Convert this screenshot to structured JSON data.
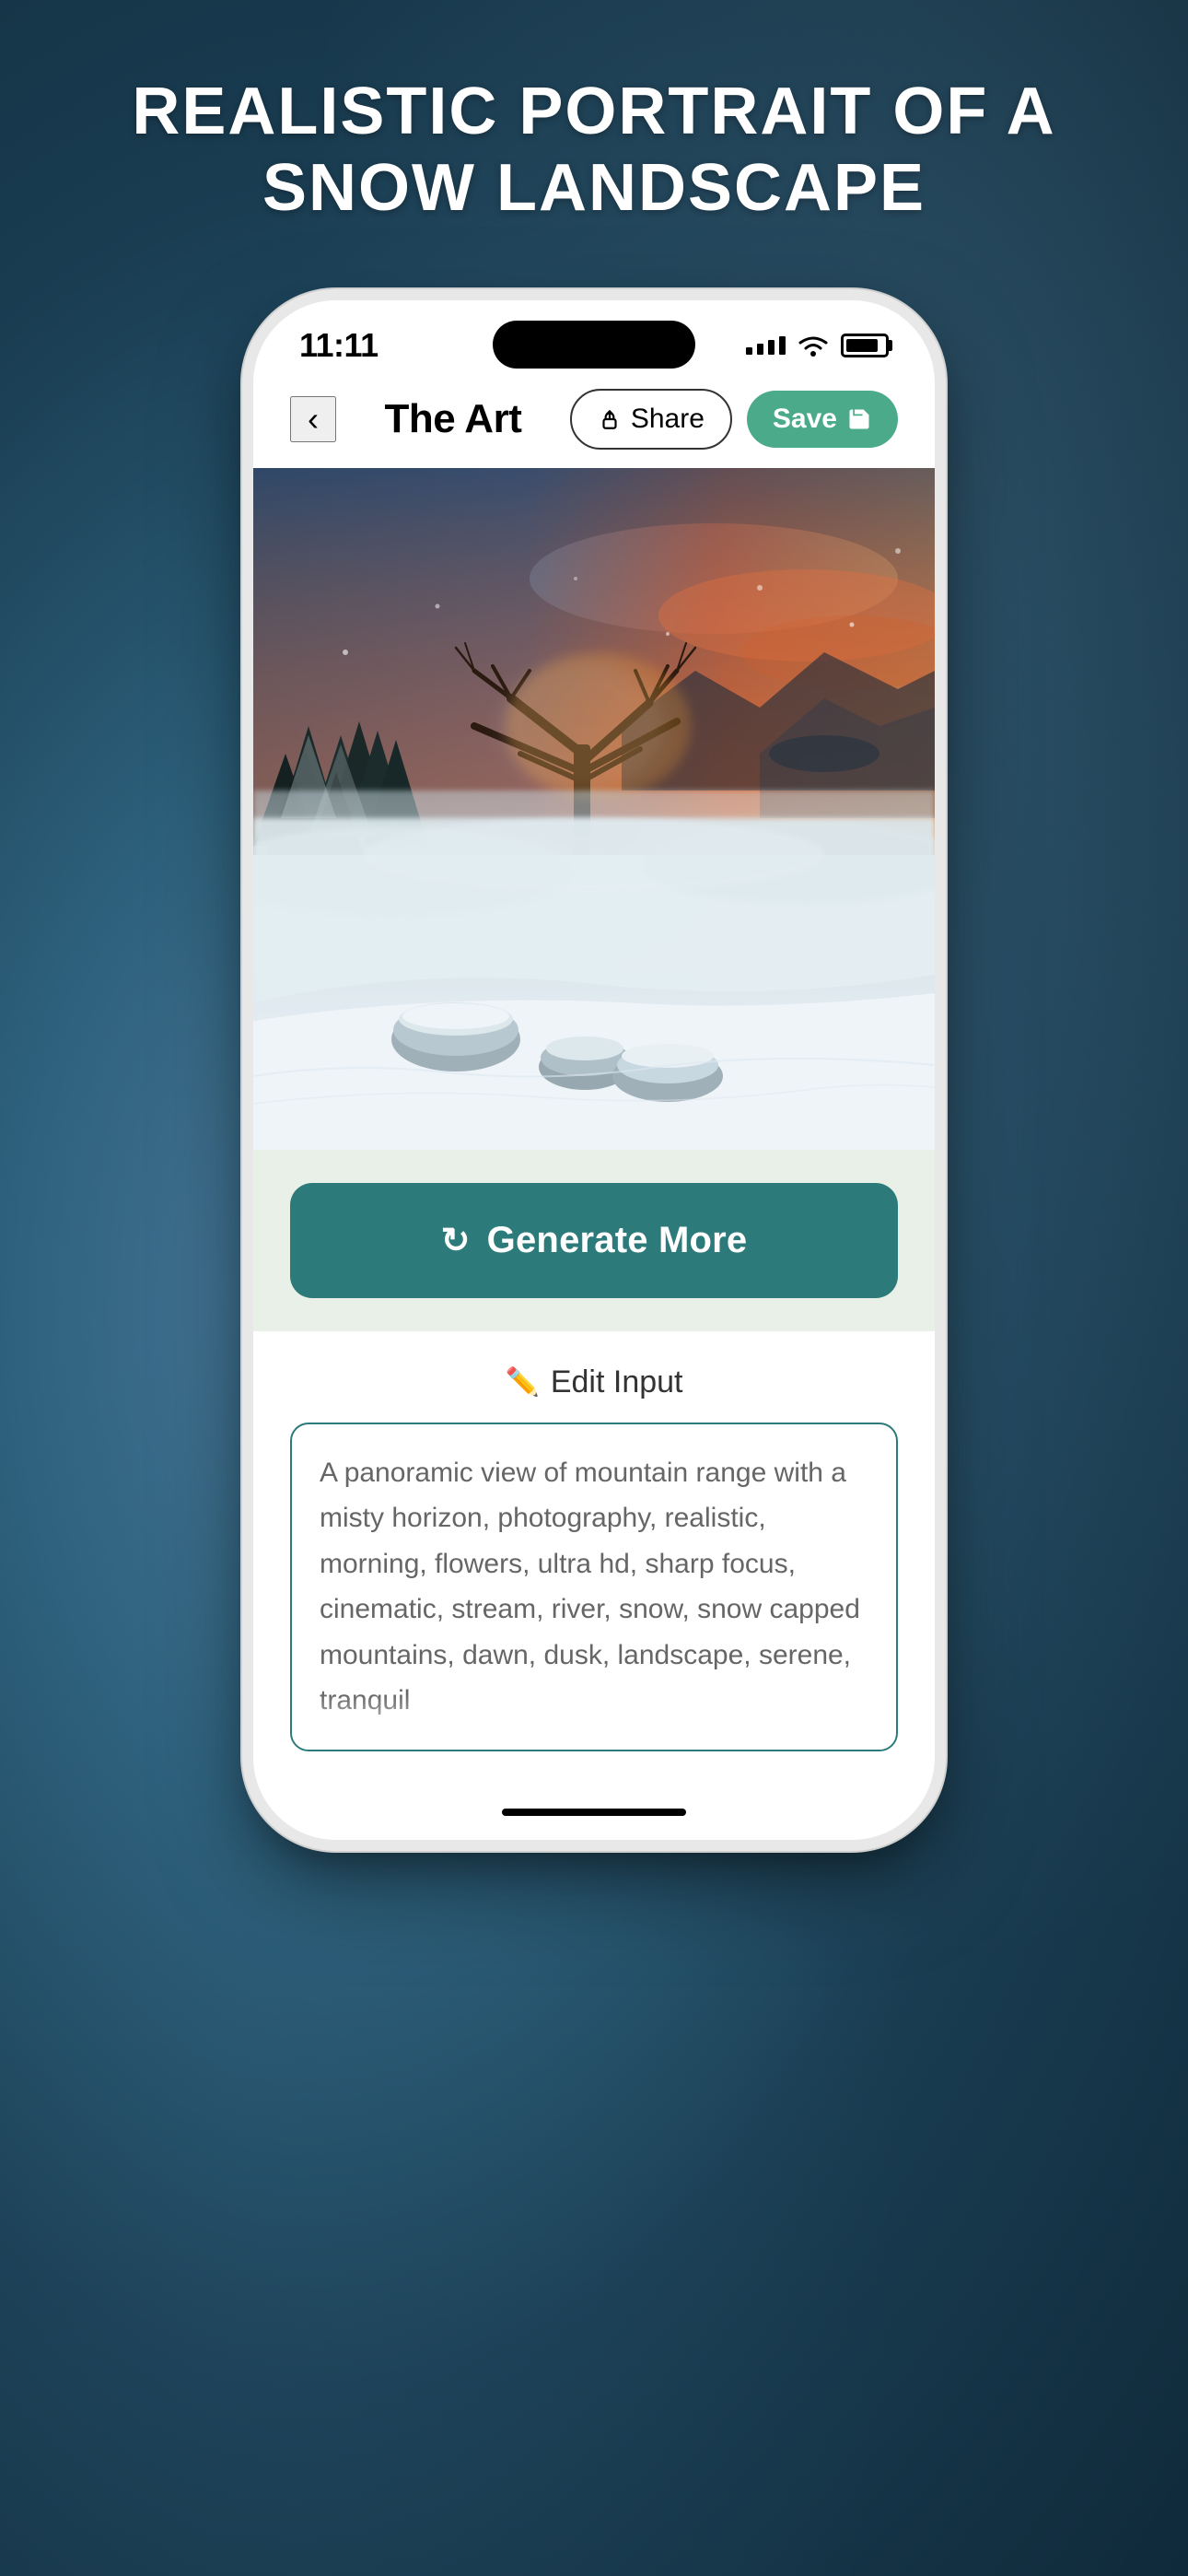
{
  "page": {
    "title": "REALISTIC PORTRAIT OF A\nSNOW LANDSCAPE",
    "background_colors": {
      "primary": "#2c5f7a",
      "secondary": "#1a3d52"
    }
  },
  "status_bar": {
    "time": "11:11",
    "signal_label": "signal",
    "wifi_label": "wifi",
    "battery_label": "battery"
  },
  "nav_bar": {
    "back_label": "‹",
    "title": "The Art",
    "share_label": "Share",
    "save_label": "Save"
  },
  "image": {
    "alt": "Realistic portrait of a snow landscape with misty winter scene, bare tree silhouette against orange sunset sky"
  },
  "generate_button": {
    "label": "Generate More",
    "icon": "↻"
  },
  "edit_section": {
    "label": "Edit Input",
    "pencil_icon": "✏",
    "prompt_text": "A panoramic view of mountain range with a misty horizon, photography, realistic, morning, flowers, ultra hd, sharp focus, cinematic, stream, river, snow, snow capped mountains, dawn, dusk, landscape, serene, tranquil"
  }
}
